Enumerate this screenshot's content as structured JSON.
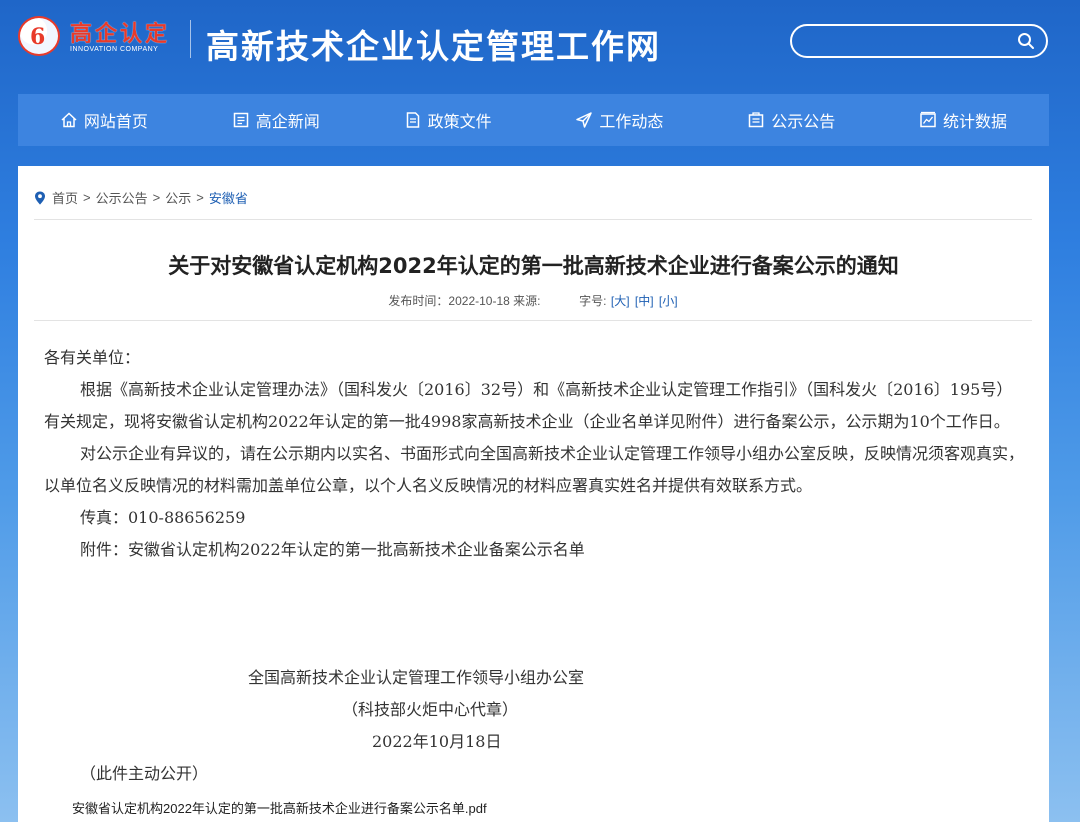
{
  "header": {
    "logo_text": "高企认定",
    "logo_en": "INNOVATION COMPANY",
    "site_title": "高新技术企业认定管理工作网",
    "search_placeholder": ""
  },
  "nav": {
    "items": [
      {
        "label": "网站首页",
        "icon": "home-icon"
      },
      {
        "label": "高企新闻",
        "icon": "news-icon"
      },
      {
        "label": "政策文件",
        "icon": "document-icon"
      },
      {
        "label": "工作动态",
        "icon": "send-icon"
      },
      {
        "label": "公示公告",
        "icon": "notice-icon"
      },
      {
        "label": "统计数据",
        "icon": "chart-icon"
      }
    ]
  },
  "breadcrumb": {
    "items": [
      "首页",
      "公示公告",
      "公示",
      "安徽省"
    ],
    "separator": ">"
  },
  "article": {
    "title": "关于对安徽省认定机构2022年认定的第一批高新技术企业进行备案公示的通知",
    "publish_label": "发布时间：2022-10-18 来源:",
    "font_size_label": "字号:",
    "font_sizes": [
      "[大]",
      "[中]",
      "[小]"
    ],
    "salutation": "各有关单位：",
    "paragraphs": [
      "根据《高新技术企业认定管理办法》（国科发火〔2016〕32号）和《高新技术企业认定管理工作指引》（国科发火〔2016〕195号）有关规定，现将安徽省认定机构2022年认定的第一批4998家高新技术企业（企业名单详见附件）进行备案公示，公示期为10个工作日。",
      "对公示企业有异议的，请在公示期内以实名、书面形式向全国高新技术企业认定管理工作领导小组办公室反映，反映情况须客观真实，以单位名义反映情况的材料需加盖单位公章，以个人名义反映情况的材料应署真实姓名并提供有效联系方式。"
    ],
    "fax": "传真：010-88656259",
    "attachment_note": "附件：安徽省认定机构2022年认定的第一批高新技术企业备案公示名单",
    "signature": {
      "org": "全国高新技术企业认定管理工作领导小组办公室",
      "seal": "（科技部火炬中心代章）",
      "date": "2022年10月18日"
    },
    "disclosure": "（此件主动公开）",
    "attachment_link": "安徽省认定机构2022年认定的第一批高新技术企业进行备案公示名单.pdf"
  },
  "colors": {
    "nav_bg": "#3d84e0",
    "logo_red": "#e83a2a",
    "link_blue": "#1e5fb3"
  }
}
